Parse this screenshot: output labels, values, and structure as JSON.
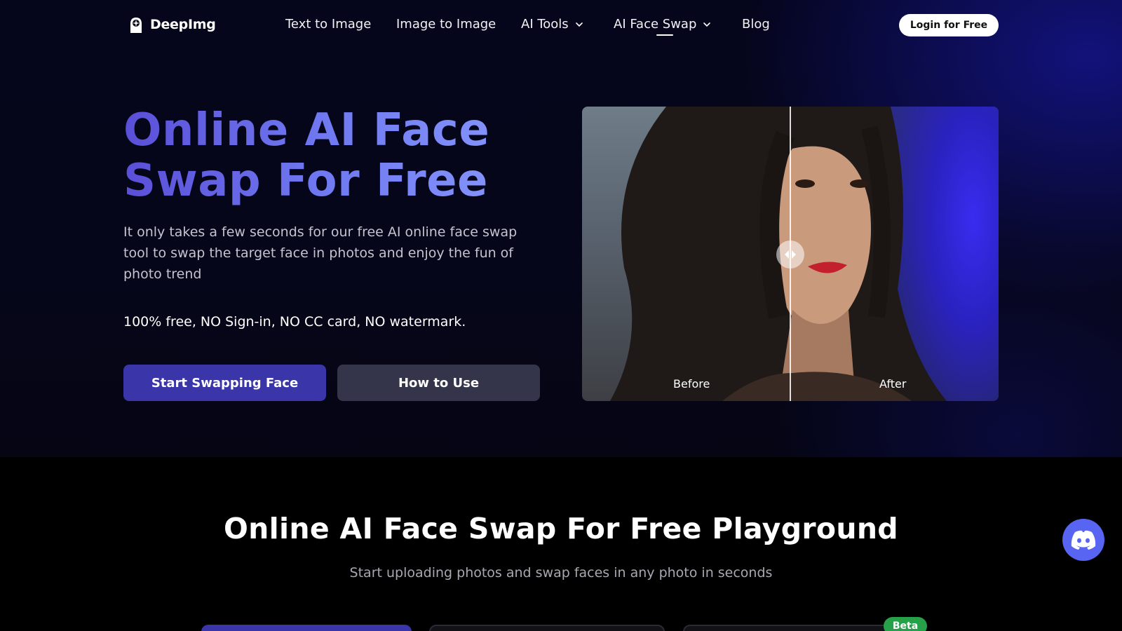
{
  "nav": {
    "logo_text": "DeepImg",
    "links": [
      {
        "label": "Text to Image"
      },
      {
        "label": "Image to Image"
      },
      {
        "label": "AI Tools"
      },
      {
        "label": "AI Face Swap"
      },
      {
        "label": "Blog"
      }
    ],
    "login_label": "Login for Free"
  },
  "hero": {
    "title_line1": "Online AI Face",
    "title_line2": "Swap For Free",
    "description": "It only takes a few seconds for our free AI online face swap tool to swap the target face in photos and enjoy the fun of photo trend",
    "free_note": "100% free, NO Sign-in, NO CC card, NO watermark.",
    "start_button": "Start Swapping Face",
    "how_button": "How to Use"
  },
  "compare": {
    "before_label": "Before",
    "after_label": "After"
  },
  "playground": {
    "title": "Online AI Face Swap For Free Playground",
    "subtitle": "Start uploading photos and swap faces in any photo in seconds",
    "beta_badge": "Beta"
  },
  "icons": {
    "logo": "deepimg-logo-icon",
    "chevron": "chevron-down-icon",
    "compare_handle": "compare-slider-icon",
    "discord": "discord-icon"
  },
  "colors": {
    "accent": "#3a35a8",
    "secondary_button": "#34344a",
    "beta": "#27a04a",
    "discord": "#5865f2"
  }
}
